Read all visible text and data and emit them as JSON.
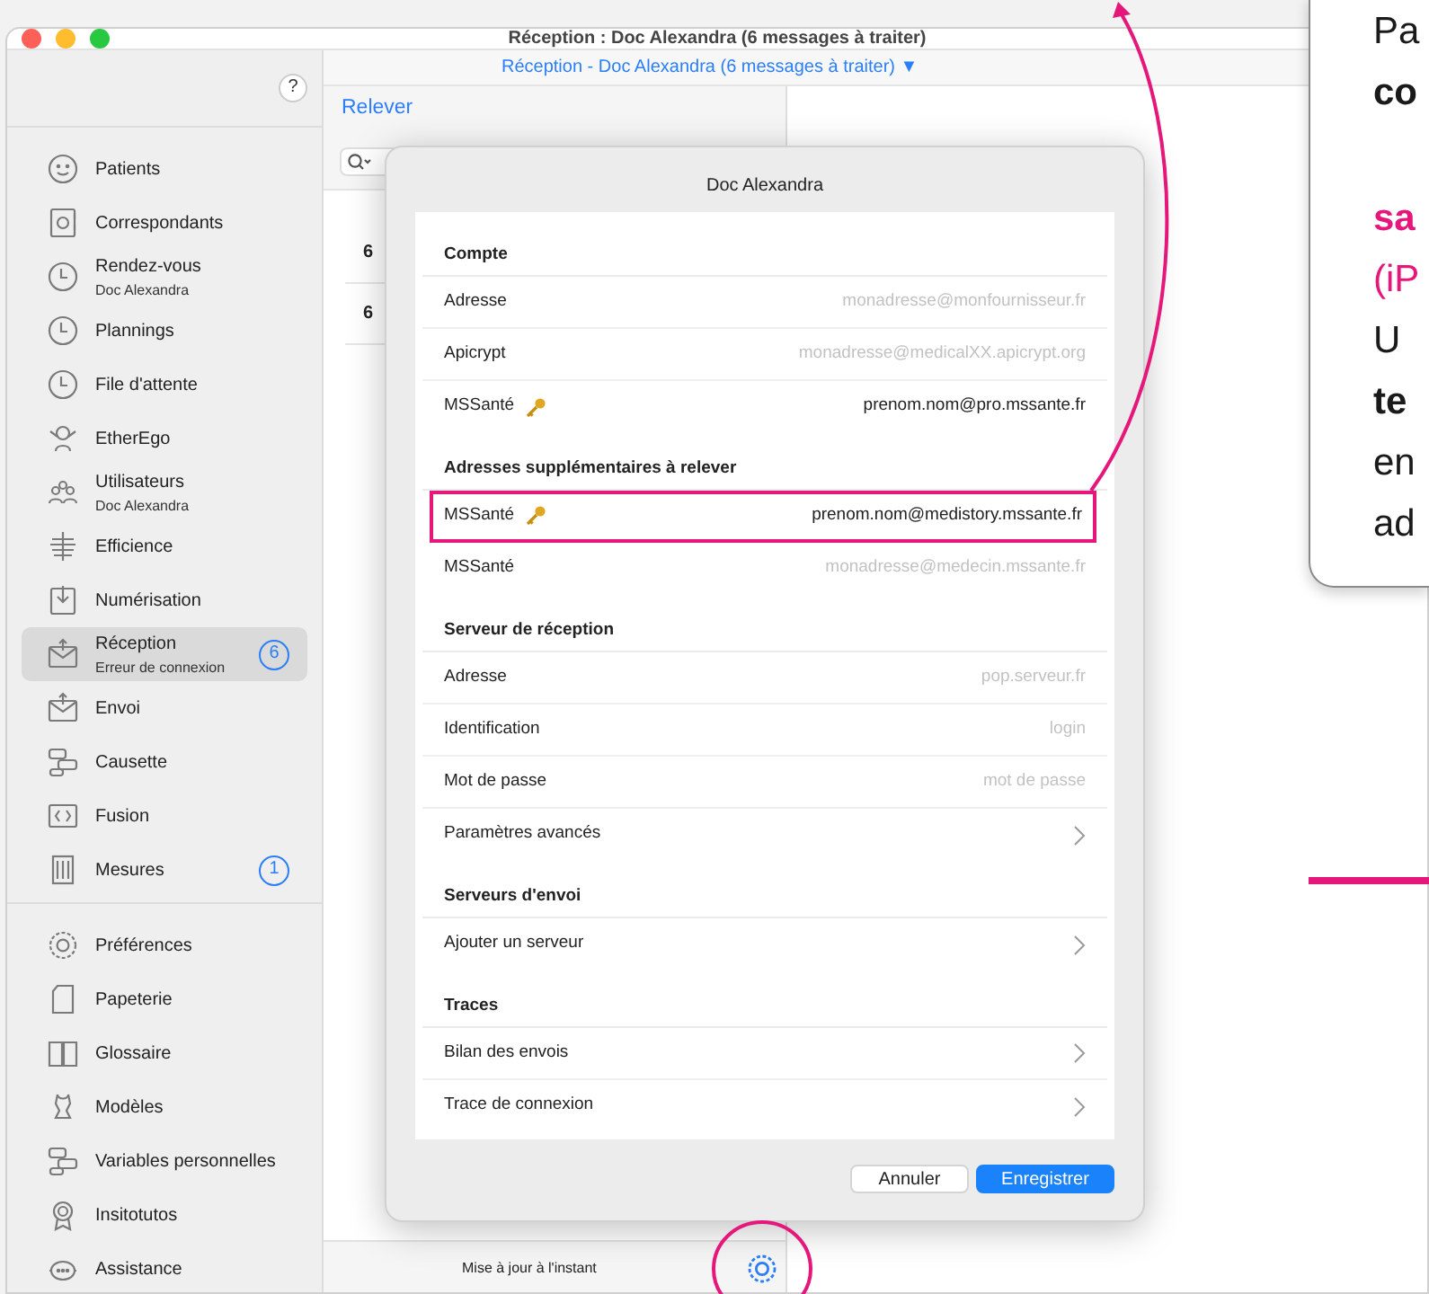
{
  "window": {
    "title": "Réception : Doc Alexandra (6 messages à traiter)"
  },
  "sidebar": {
    "help_button": "?",
    "groups": [
      [
        {
          "label": "Patients",
          "selected": false
        },
        {
          "label": "Correspondants",
          "selected": false
        },
        {
          "label": "Rendez-vous",
          "sublabel": "Doc Alexandra",
          "selected": false
        },
        {
          "label": "Plannings",
          "selected": false
        },
        {
          "label": "File d'attente",
          "selected": false
        },
        {
          "label": "EtherEgo",
          "selected": false
        },
        {
          "label": "Utilisateurs",
          "sublabel": "Doc Alexandra",
          "selected": false
        },
        {
          "label": "Efficience",
          "selected": false
        },
        {
          "label": "Numérisation",
          "selected": false
        },
        {
          "label": "Réception",
          "sublabel": "Erreur de connexion",
          "badge": "6",
          "selected": true
        },
        {
          "label": "Envoi",
          "selected": false
        },
        {
          "label": "Causette",
          "selected": false
        },
        {
          "label": "Fusion",
          "selected": false
        },
        {
          "label": "Mesures",
          "badge": "1",
          "selected": false
        }
      ],
      [
        {
          "label": "Préférences",
          "selected": false
        },
        {
          "label": "Papeterie",
          "selected": false
        },
        {
          "label": "Glossaire",
          "selected": false
        },
        {
          "label": "Modèles",
          "selected": false
        },
        {
          "label": "Variables personnelles",
          "selected": false
        },
        {
          "label": "Insitotutos",
          "selected": false
        },
        {
          "label": "Assistance",
          "selected": false
        }
      ]
    ]
  },
  "main": {
    "header": "Réception - Doc Alexandra (6 messages à traiter) ▼",
    "toolbar_button": "Relever",
    "list_rows": [
      "6",
      "6"
    ],
    "status": "Mise à jour à l'instant"
  },
  "dialog": {
    "title": "Doc Alexandra",
    "sections": [
      {
        "heading": "Compte",
        "rows": [
          {
            "kind": "field",
            "label": "Adresse",
            "placeholder": "monadresse@monfournisseur.fr",
            "key_icon": false,
            "highlighted": false
          },
          {
            "kind": "field",
            "label": "Apicrypt",
            "placeholder": "monadresse@medicalXX.apicrypt.org",
            "key_icon": false,
            "highlighted": false
          },
          {
            "kind": "field",
            "label": "MSSanté",
            "value": "prenom.nom@pro.mssante.fr",
            "key_icon": true,
            "highlighted": false
          }
        ]
      },
      {
        "heading": "Adresses supplémentaires à relever",
        "rows": [
          {
            "kind": "field",
            "label": "MSSanté",
            "value": "prenom.nom@medistory.mssante.fr",
            "key_icon": true,
            "highlighted": true
          },
          {
            "kind": "field",
            "label": "MSSanté",
            "placeholder": "monadresse@medecin.mssante.fr",
            "key_icon": false,
            "highlighted": false
          }
        ]
      },
      {
        "heading": "Serveur de réception",
        "rows": [
          {
            "kind": "field",
            "label": "Adresse",
            "placeholder": "pop.serveur.fr",
            "key_icon": false,
            "highlighted": false
          },
          {
            "kind": "field",
            "label": "Identification",
            "placeholder": "login",
            "key_icon": false,
            "highlighted": false
          },
          {
            "kind": "field",
            "label": "Mot de passe",
            "placeholder": "mot de passe",
            "key_icon": false,
            "highlighted": false
          },
          {
            "kind": "link",
            "label": "Paramètres avancés",
            "key_icon": false,
            "highlighted": false
          }
        ]
      },
      {
        "heading": "Serveurs d'envoi",
        "rows": [
          {
            "kind": "link",
            "label": "Ajouter un serveur",
            "key_icon": false,
            "highlighted": false
          }
        ]
      },
      {
        "heading": "Traces",
        "rows": [
          {
            "kind": "link",
            "label": "Bilan des envois",
            "key_icon": false,
            "highlighted": false
          },
          {
            "kind": "link",
            "label": "Trace de connexion",
            "key_icon": false,
            "highlighted": false
          }
        ]
      }
    ],
    "buttons": [
      {
        "label": "Annuler",
        "kind": "secondary"
      },
      {
        "label": "Enregistrer",
        "kind": "primary"
      }
    ]
  },
  "callout": {
    "lines": [
      {
        "text": "Pa",
        "kind": "plain"
      },
      {
        "text": "co",
        "kind": "bold"
      },
      {
        "kind": "gap"
      },
      {
        "text": "sa",
        "kind": "accent-bold"
      },
      {
        "text": "(iP",
        "kind": "accent"
      },
      {
        "text": "U",
        "kind": "plain"
      },
      {
        "text": "te",
        "kind": "bold"
      },
      {
        "text": "en",
        "kind": "plain"
      },
      {
        "text": "ad",
        "kind": "plain"
      }
    ]
  }
}
